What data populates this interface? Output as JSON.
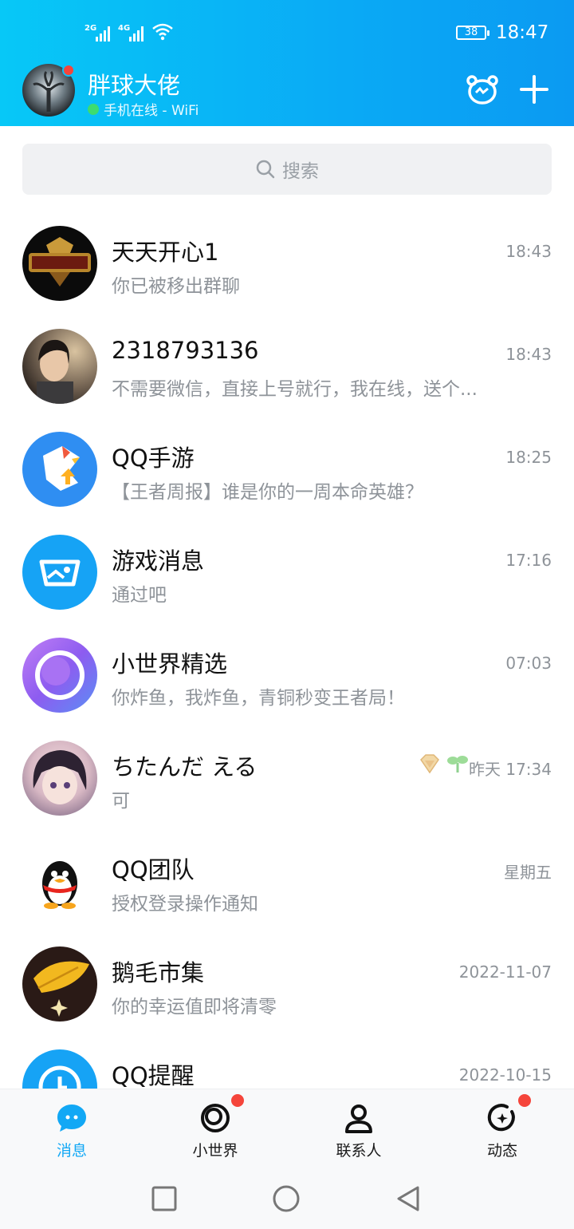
{
  "status": {
    "sig1": "2G",
    "sig2": "4G",
    "battery": "38",
    "time": "18:47"
  },
  "profile": {
    "name": "胖球大佬",
    "status": "手机在线 - WiFi"
  },
  "search": {
    "placeholder": "搜索"
  },
  "chats": [
    {
      "name": "天天开心1",
      "message": "你已被移出群聊",
      "time": "18:43"
    },
    {
      "name": "2318793136",
      "message": "不需要微信，直接上号就行，我在线，送个...",
      "time": "18:43"
    },
    {
      "name": "QQ手游",
      "message": "【王者周报】谁是你的一周本命英雄？",
      "time": "18:25"
    },
    {
      "name": "游戏消息",
      "message": "通过吧",
      "time": "17:16"
    },
    {
      "name": "小世界精选",
      "message": "你炸鱼，我炸鱼，青铜秒变王者局！",
      "time": "07:03"
    },
    {
      "name": "ちたんだ える",
      "message": "可",
      "time": "昨天 17:34"
    },
    {
      "name": "QQ团队",
      "message": "授权登录操作通知",
      "time": "星期五"
    },
    {
      "name": "鹅毛市集",
      "message": "你的幸运值即将清零",
      "time": "2022-11-07"
    },
    {
      "name": "QQ提醒",
      "message": "",
      "time": "2022-10-15"
    }
  ],
  "tabs": [
    {
      "label": "消息"
    },
    {
      "label": "小世界"
    },
    {
      "label": "联系人"
    },
    {
      "label": "动态"
    }
  ],
  "colors": {
    "accent": "#12a8f5",
    "badge_red": "#f5453b",
    "online_green": "#3ddc6f"
  }
}
